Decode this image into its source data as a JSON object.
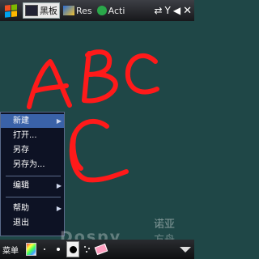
{
  "taskbar": {
    "tasks": [
      {
        "label": "黑板",
        "active": true
      },
      {
        "label": "Res",
        "active": false
      },
      {
        "label": "Acti",
        "active": false
      }
    ],
    "tray_icons": [
      "sync-icon",
      "signal-icon",
      "volume-icon"
    ],
    "close_label": "✕"
  },
  "canvas": {
    "ink_color": "#ff1a1a",
    "background": "#1f4747"
  },
  "menu": {
    "items": [
      {
        "label": "新建",
        "submenu": true
      },
      {
        "label": "打开...",
        "submenu": false
      },
      {
        "label": "另存",
        "submenu": false
      },
      {
        "label": "另存为...",
        "submenu": false
      },
      {
        "label": "编辑",
        "submenu": true
      },
      {
        "label": "帮助",
        "submenu": true
      },
      {
        "label": "退出",
        "submenu": false
      }
    ],
    "selected_index": 0
  },
  "watermark": {
    "text": "Dospy",
    "cn_line1": "诺亚",
    "cn_line2": "方舟"
  },
  "bottombar": {
    "menu_label": "菜单",
    "tools": [
      "color-palette-icon",
      "small-dot-icon",
      "medium-dot-icon",
      "large-dot-icon",
      "spray-dot-icon",
      "eraser-icon"
    ]
  }
}
